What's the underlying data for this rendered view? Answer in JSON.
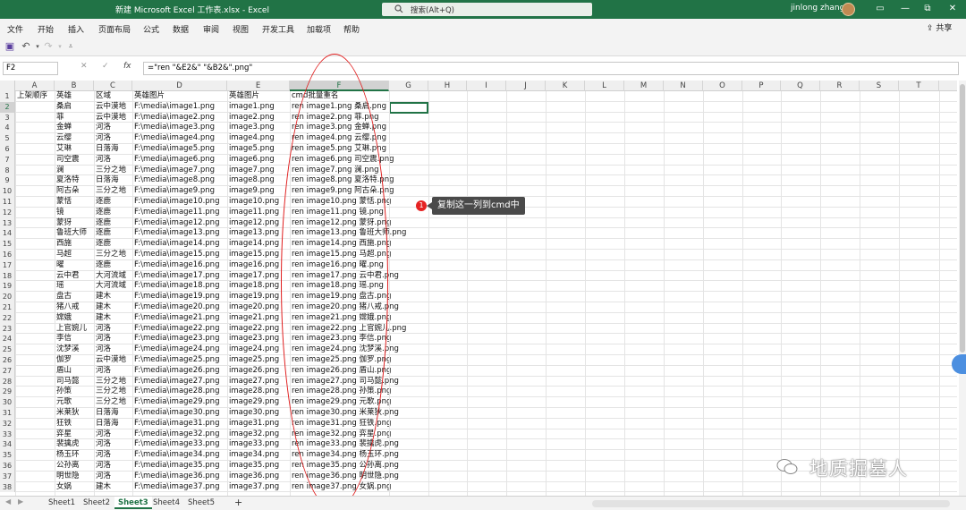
{
  "titlebar": {
    "document_title": "新建 Microsoft Excel 工作表.xlsx  -  Excel",
    "search_placeholder": "搜索(Alt+Q)",
    "user_name": "jinlong zhang",
    "minimize": "—",
    "restore": "⧉",
    "close": "✕"
  },
  "menu": {
    "items": [
      "文件",
      "开始",
      "插入",
      "页面布局",
      "公式",
      "数据",
      "审阅",
      "视图",
      "开发工具",
      "加载项",
      "帮助"
    ],
    "share": "共享"
  },
  "formula_bar": {
    "name_box": "F2",
    "formula": "=\"ren \"&E2&\" \"&B2&\".png\""
  },
  "columns": [
    "A",
    "B",
    "C",
    "D",
    "E",
    "F",
    "G",
    "H",
    "I",
    "J",
    "K",
    "L",
    "M",
    "N",
    "O",
    "P",
    "Q",
    "R",
    "S",
    "T"
  ],
  "selected_column": "F",
  "header_row": [
    "上架顺序",
    "英雄",
    "区域",
    "英雄图片",
    "英雄图片",
    "cmd批量重名"
  ],
  "rows": [
    [
      "",
      "桑启",
      "云中漠地",
      "F:\\media\\image1.png",
      "image1.png",
      "ren image1.png 桑启.png"
    ],
    [
      "",
      "菲",
      "云中漠地",
      "F:\\media\\image2.png",
      "image2.png",
      "ren image2.png 菲.png"
    ],
    [
      "",
      "金蝉",
      "河洛",
      "F:\\media\\image3.png",
      "image3.png",
      "ren image3.png 金蝉.png"
    ],
    [
      "",
      "云缨",
      "河洛",
      "F:\\media\\image4.png",
      "image4.png",
      "ren image4.png 云缨.png"
    ],
    [
      "",
      "艾琳",
      "日落海",
      "F:\\media\\image5.png",
      "image5.png",
      "ren image5.png 艾琳.png"
    ],
    [
      "",
      "司空震",
      "河洛",
      "F:\\media\\image6.png",
      "image6.png",
      "ren image6.png 司空震.png"
    ],
    [
      "",
      "澜",
      "三分之地",
      "F:\\media\\image7.png",
      "image7.png",
      "ren image7.png 澜.png"
    ],
    [
      "",
      "夏洛特",
      "日落海",
      "F:\\media\\image8.png",
      "image8.png",
      "ren image8.png 夏洛特.png"
    ],
    [
      "",
      "阿古朵",
      "三分之地",
      "F:\\media\\image9.png",
      "image9.png",
      "ren image9.png 阿古朵.png"
    ],
    [
      "",
      "蒙恬",
      "逐鹿",
      "F:\\media\\image10.png",
      "image10.png",
      "ren image10.png 蒙恬.png"
    ],
    [
      "",
      "镜",
      "逐鹿",
      "F:\\media\\image11.png",
      "image11.png",
      "ren image11.png 镜.png"
    ],
    [
      "",
      "蒙犽",
      "逐鹿",
      "F:\\media\\image12.png",
      "image12.png",
      "ren image12.png 蒙犽.png"
    ],
    [
      "",
      "鲁班大师",
      "逐鹿",
      "F:\\media\\image13.png",
      "image13.png",
      "ren image13.png 鲁班大师.png"
    ],
    [
      "",
      "西施",
      "逐鹿",
      "F:\\media\\image14.png",
      "image14.png",
      "ren image14.png 西施.png"
    ],
    [
      "",
      "马超",
      "三分之地",
      "F:\\media\\image15.png",
      "image15.png",
      "ren image15.png 马超.png"
    ],
    [
      "",
      "曜",
      "逐鹿",
      "F:\\media\\image16.png",
      "image16.png",
      "ren image16.png 曜.png"
    ],
    [
      "",
      "云中君",
      "大河流域",
      "F:\\media\\image17.png",
      "image17.png",
      "ren image17.png 云中君.png"
    ],
    [
      "",
      "瑶",
      "大河流域",
      "F:\\media\\image18.png",
      "image18.png",
      "ren image18.png 瑶.png"
    ],
    [
      "",
      "盘古",
      "建木",
      "F:\\media\\image19.png",
      "image19.png",
      "ren image19.png 盘古.png"
    ],
    [
      "",
      "猪八戒",
      "建木",
      "F:\\media\\image20.png",
      "image20.png",
      "ren image20.png 猪八戒.png"
    ],
    [
      "",
      "嫦娥",
      "建木",
      "F:\\media\\image21.png",
      "image21.png",
      "ren image21.png 嫦娥.png"
    ],
    [
      "",
      "上官婉儿",
      "河洛",
      "F:\\media\\image22.png",
      "image22.png",
      "ren image22.png 上官婉儿.png"
    ],
    [
      "",
      "李信",
      "河洛",
      "F:\\media\\image23.png",
      "image23.png",
      "ren image23.png 李信.png"
    ],
    [
      "",
      "沈梦溪",
      "河洛",
      "F:\\media\\image24.png",
      "image24.png",
      "ren image24.png 沈梦溪.png"
    ],
    [
      "",
      "伽罗",
      "云中漠地",
      "F:\\media\\image25.png",
      "image25.png",
      "ren image25.png 伽罗.png"
    ],
    [
      "",
      "盾山",
      "河洛",
      "F:\\media\\image26.png",
      "image26.png",
      "ren image26.png 盾山.png"
    ],
    [
      "",
      "司马懿",
      "三分之地",
      "F:\\media\\image27.png",
      "image27.png",
      "ren image27.png 司马懿.png"
    ],
    [
      "",
      "孙策",
      "三分之地",
      "F:\\media\\image28.png",
      "image28.png",
      "ren image28.png 孙策.png"
    ],
    [
      "",
      "元歌",
      "三分之地",
      "F:\\media\\image29.png",
      "image29.png",
      "ren image29.png 元歌.png"
    ],
    [
      "",
      "米莱狄",
      "日落海",
      "F:\\media\\image30.png",
      "image30.png",
      "ren image30.png 米莱狄.png"
    ],
    [
      "",
      "狂铁",
      "日落海",
      "F:\\media\\image31.png",
      "image31.png",
      "ren image31.png 狂铁.png"
    ],
    [
      "",
      "弈星",
      "河洛",
      "F:\\media\\image32.png",
      "image32.png",
      "ren image32.png 弈星.png"
    ],
    [
      "",
      "裴擒虎",
      "河洛",
      "F:\\media\\image33.png",
      "image33.png",
      "ren image33.png 裴擒虎.png"
    ],
    [
      "",
      "杨玉环",
      "河洛",
      "F:\\media\\image34.png",
      "image34.png",
      "ren image34.png 杨玉环.png"
    ],
    [
      "",
      "公孙离",
      "河洛",
      "F:\\media\\image35.png",
      "image35.png",
      "ren image35.png 公孙离.png"
    ],
    [
      "",
      "明世隐",
      "河洛",
      "F:\\media\\image36.png",
      "image36.png",
      "ren image36.png 明世隐.png"
    ],
    [
      "",
      "女娲",
      "建木",
      "F:\\media\\image37.png",
      "image37.png",
      "ren image37.png 女娲.png"
    ]
  ],
  "annotation": {
    "number": "1",
    "text": "复制这一列到cmd中",
    "color": "#e52222"
  },
  "sheets": [
    "Sheet1",
    "Sheet2",
    "Sheet3",
    "Sheet4",
    "Sheet5"
  ],
  "active_sheet": "Sheet3",
  "add_sheet": "+",
  "watermark": "地质掘墓人",
  "accent_color": "#217346"
}
